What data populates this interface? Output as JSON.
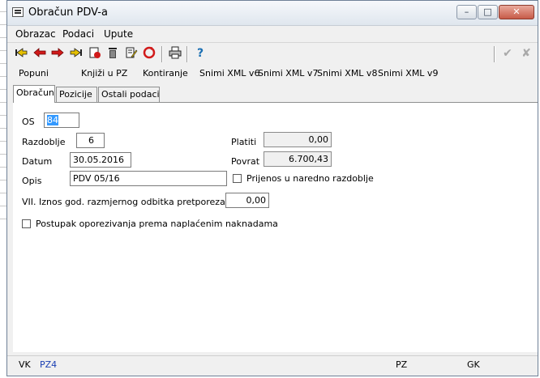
{
  "window": {
    "title": "Obračun PDV-a"
  },
  "window_controls": {
    "min": "–",
    "max": "□",
    "close": "✕"
  },
  "menu": [
    "Obrazac",
    "Podaci",
    "Upute"
  ],
  "toolbar_icons": [
    "first-record-icon",
    "previous-record-icon",
    "next-record-icon",
    "last-record-icon",
    "new-record-icon",
    "delete-icon",
    "edit-icon",
    "refresh-icon",
    "print-icon",
    "help-icon",
    "confirm-icon",
    "cancel-icon"
  ],
  "toolbar_glyphs": {
    "help": "?",
    "confirm": "✔",
    "cancel": "✘"
  },
  "actions": [
    "Popuni",
    "Knjiži u PZ",
    "Kontiranje",
    "Snimi XML v6",
    "Snimi XML v7",
    "Snimi XML v8",
    "Snimi XML v9"
  ],
  "tabs": [
    "Obračun",
    "Pozicije",
    "Ostali podaci"
  ],
  "form": {
    "os_label": "OS",
    "os_value": "84",
    "razdoblje_label": "Razdoblje",
    "razdoblje_value": "6",
    "datum_label": "Datum",
    "datum_value": "30.05.2016",
    "opis_label": "Opis",
    "opis_value": "PDV 05/16",
    "platiti_label": "Platiti",
    "platiti_value": "0,00",
    "povrat_label": "Povrat",
    "povrat_value": "6.700,43",
    "prijenos_label": "Prijenos u naredno razdoblje",
    "iznos_label": "VII. Iznos god. razmjernog odbitka pretporeza %",
    "iznos_value": "0,00",
    "postupak_label": "Postupak oporezivanja prema naplaćenim naknadama"
  },
  "status": {
    "vk_label": "VK",
    "vk_value": "PZ4",
    "pz": "PZ",
    "gk": "GK"
  }
}
